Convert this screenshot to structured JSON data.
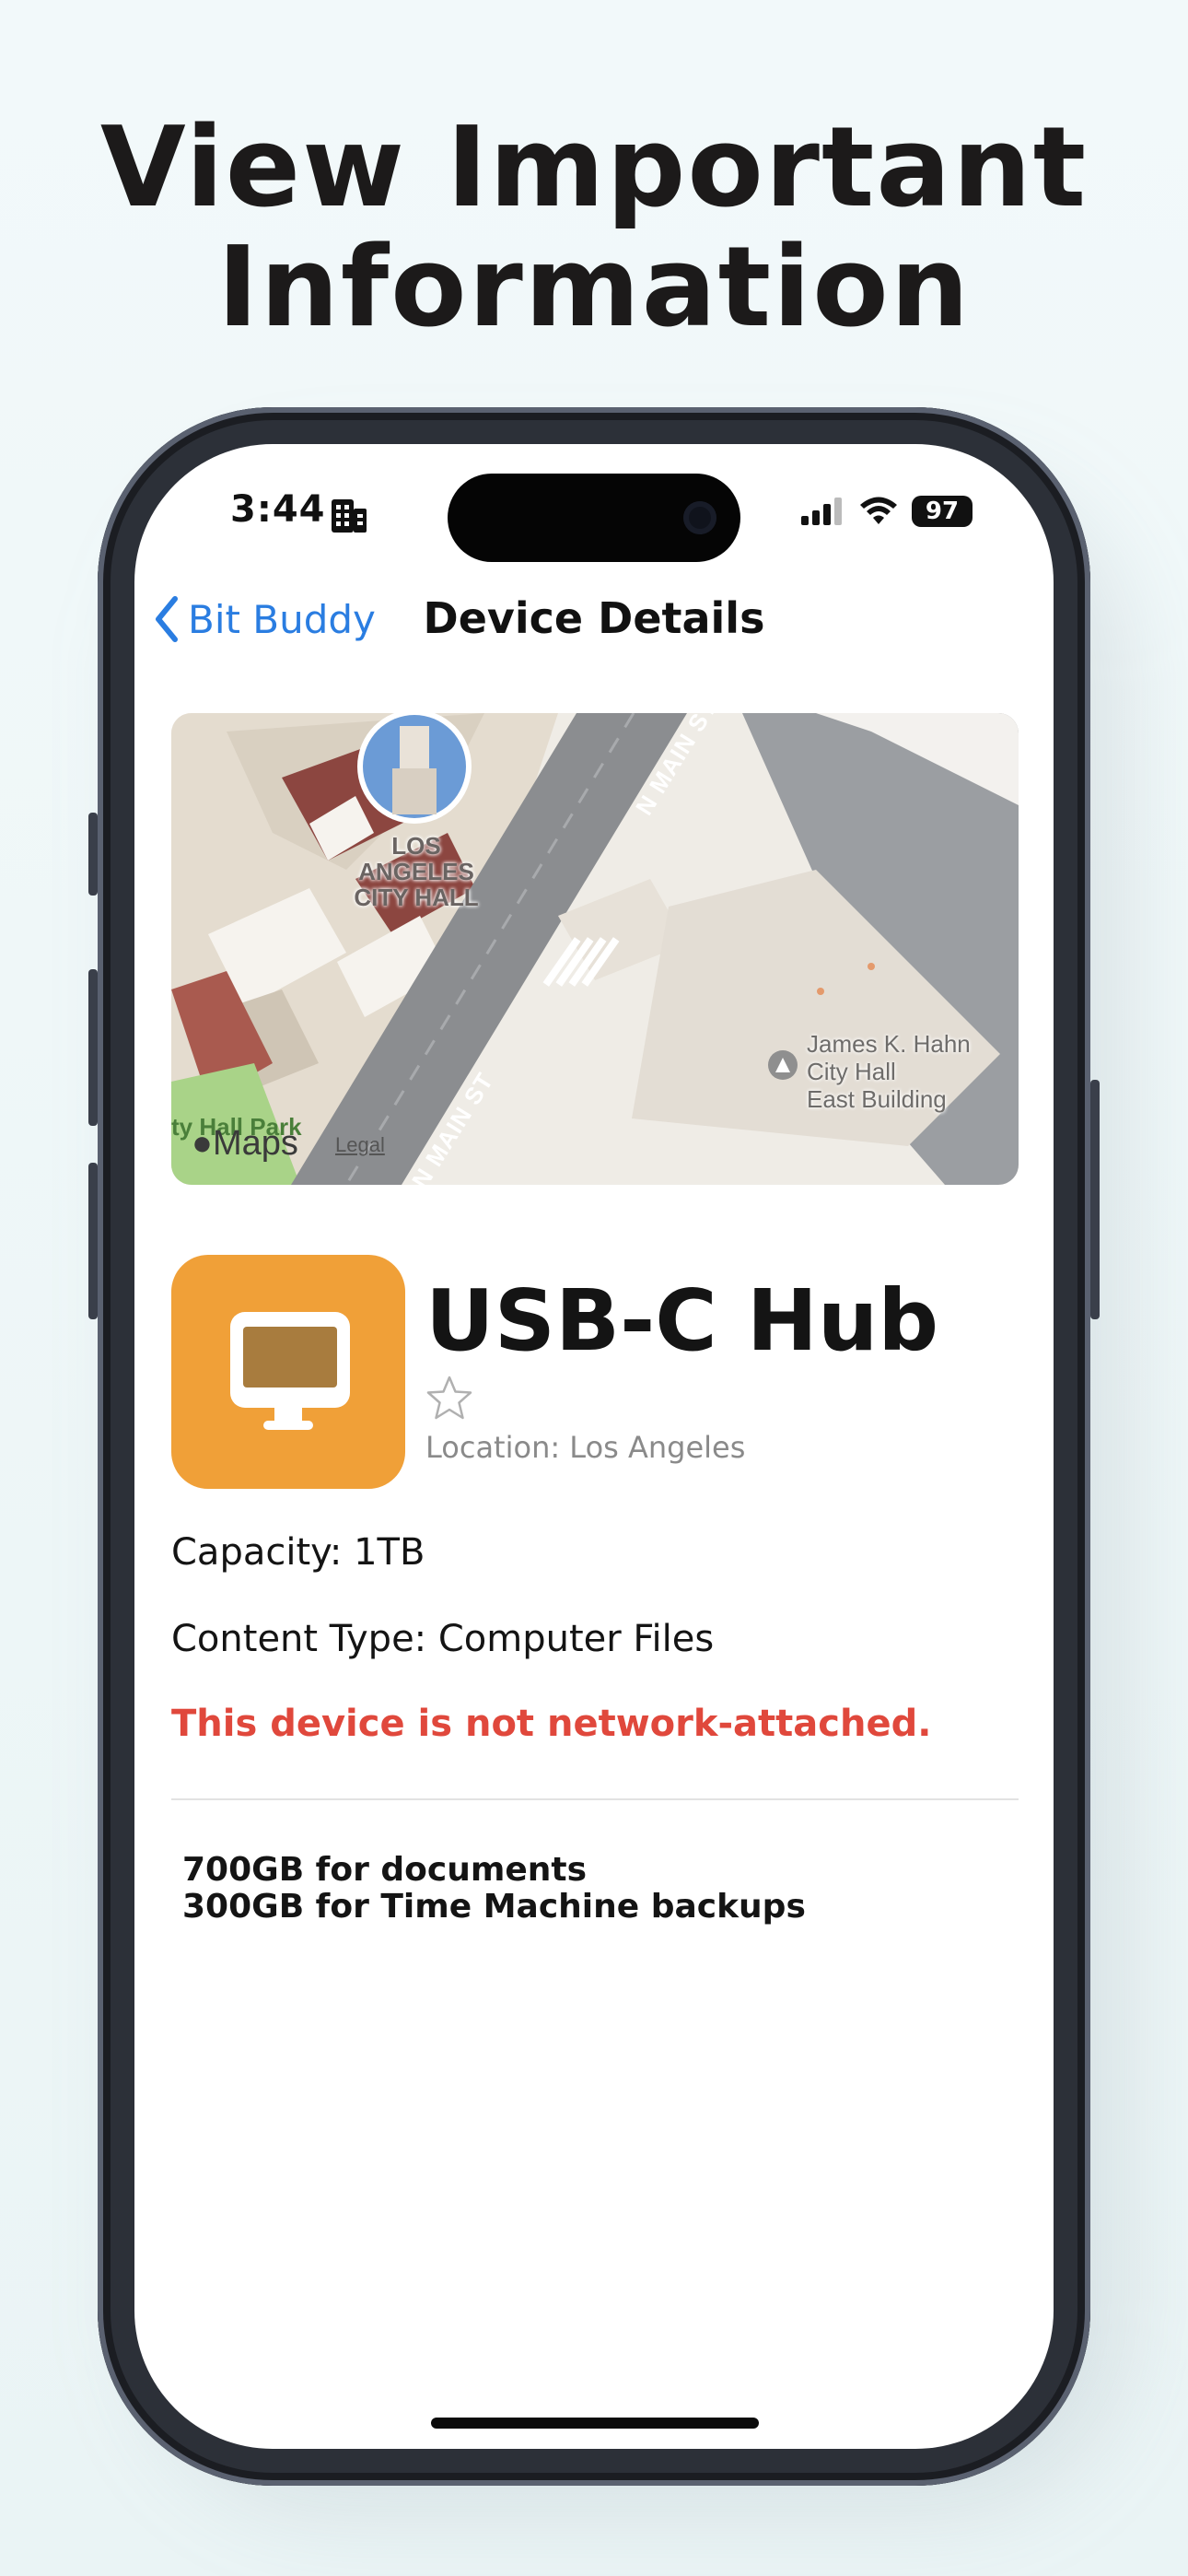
{
  "headline": {
    "line1": "View Important",
    "line2": "Information"
  },
  "status_bar": {
    "time": "3:44",
    "battery": "97",
    "icons": [
      "building-icon",
      "signal-icon",
      "wifi-icon",
      "battery-icon"
    ]
  },
  "nav": {
    "back_label": "Bit Buddy",
    "title": "Device Details"
  },
  "map": {
    "landmark_label_line1": "LOS ANGELES",
    "landmark_label_line2": "CITY HALL",
    "street_top": "N MAIN ST",
    "street_bottom": "N MAIN ST",
    "poi_line1": "James K. Hahn",
    "poi_line2": "City Hall",
    "poi_line3": "East Building",
    "park_label": "ty Hall Park",
    "brand": "Maps",
    "legal": "Legal"
  },
  "device": {
    "name": "USB-C Hub",
    "location": "Location: Los Angeles",
    "favorite": false,
    "capacity": "Capacity: 1TB",
    "content_type": "Content Type: Computer Files",
    "warning": "This device is not network-attached.",
    "notes_line1": "700GB for documents",
    "notes_line2": "300GB for Time Machine backups"
  },
  "colors": {
    "accent_blue": "#2a7de1",
    "warning_red": "#e0483c",
    "icon_orange": "#f0a038"
  }
}
